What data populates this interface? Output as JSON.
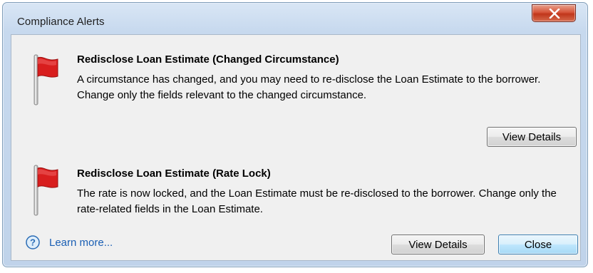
{
  "window": {
    "title": "Compliance Alerts"
  },
  "alerts": [
    {
      "title": "Redisclose Loan Estimate (Changed Circumstance)",
      "body": "A circumstance has changed, and you may need to re-disclose the Loan Estimate to the borrower. Change only the fields relevant to the changed circumstance.",
      "button_label": "View Details"
    },
    {
      "title": "Redisclose Loan Estimate (Rate Lock)",
      "body": "The rate is now locked, and the Loan Estimate must be re-disclosed to the borrower. Change only the rate-related fields in the Loan Estimate.",
      "button_label": "View Details"
    }
  ],
  "footer": {
    "learn_more": "Learn more...",
    "close_label": "Close"
  },
  "icons": {
    "window_close": "close-icon",
    "alert_flag": "red-flag-icon",
    "help": "question-circle-icon"
  },
  "colors": {
    "flag_red": "#d81e1e",
    "link_blue": "#1a5fb4",
    "close_button_red": "#c0361b"
  }
}
